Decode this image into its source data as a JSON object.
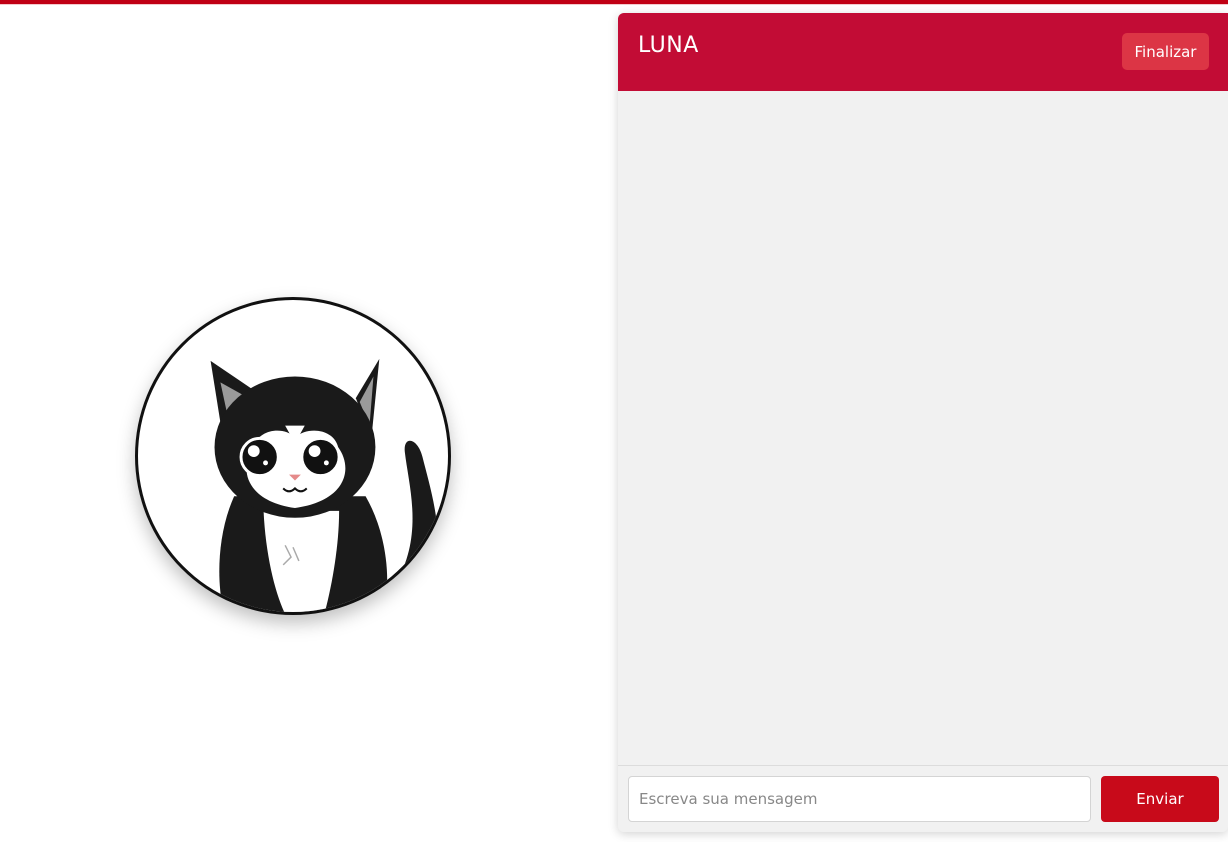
{
  "colors": {
    "accent": "#c20c35",
    "finish_button": "#dc3545",
    "send_button": "#c80a1a",
    "top_bar": "#c00014",
    "chat_background": "#f1f1f1"
  },
  "avatar": {
    "icon": "cat-avatar-icon"
  },
  "chat": {
    "title": "LUNA",
    "finish_label": "Finalizar",
    "messages": [],
    "input_placeholder": "Escreva sua mensagem",
    "input_value": "",
    "send_label": "Enviar"
  }
}
